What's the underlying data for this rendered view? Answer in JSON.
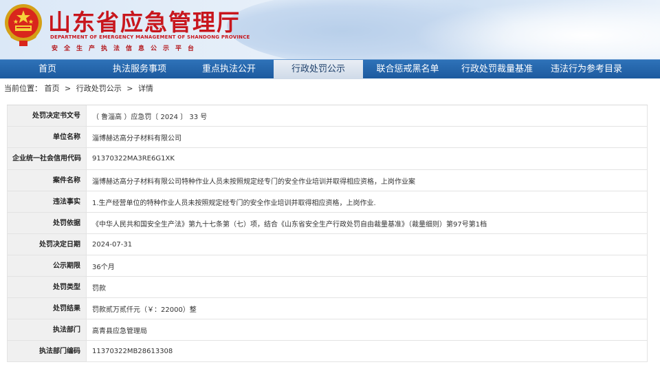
{
  "header": {
    "title_cn": "山东省应急管理厅",
    "title_en": "DEPARTMENT OF EMERGENCY MANAGEMENT OF SHANDONG PROVINCE",
    "subtitle": "安全生产执法信息公示平台",
    "accent_color": "#c8161d"
  },
  "nav": {
    "items": [
      {
        "label": "首页"
      },
      {
        "label": "执法服务事项"
      },
      {
        "label": "重点执法公开"
      },
      {
        "label": "行政处罚公示"
      },
      {
        "label": "联合惩戒黑名单"
      },
      {
        "label": "行政处罚裁量基准"
      },
      {
        "label": "违法行为参考目录"
      }
    ],
    "active_index": 3,
    "color": "#2e72b8"
  },
  "breadcrumb": {
    "prefix": "当前位置：",
    "items": [
      "首页",
      "行政处罚公示",
      "详情"
    ],
    "separator": ">"
  },
  "detail": {
    "rows": [
      {
        "label": "处罚决定书文号",
        "value": "（ 鲁淄高 ）应急罚〔 2024 〕 33 号"
      },
      {
        "label": "单位名称",
        "value": "淄博赫达高分子材料有限公司"
      },
      {
        "label": "企业统一社会信用代码",
        "value": "91370322MA3RE6G1XK"
      },
      {
        "label": "案件名称",
        "value": "淄博赫达高分子材料有限公司特种作业人员未按照规定经专门的安全作业培训并取得相应资格，上岗作业案"
      },
      {
        "label": "违法事实",
        "value": "1.生产经营单位的特种作业人员未按照规定经专门的安全作业培训并取得相应资格，上岗作业."
      },
      {
        "label": "处罚依据",
        "value": "《中华人民共和国安全生产法》第九十七条第（七）项，结合《山东省安全生产行政处罚自由裁量基准》（裁量细则）第97号第1档"
      },
      {
        "label": "处罚决定日期",
        "value": "2024-07-31"
      },
      {
        "label": "公示期限",
        "value": "36个月"
      },
      {
        "label": "处罚类型",
        "value": "罚款"
      },
      {
        "label": "处罚结果",
        "value": "罚款贰万贰仟元（￥：22000）整"
      },
      {
        "label": "执法部门",
        "value": "高青县应急管理局"
      },
      {
        "label": "执法部门编码",
        "value": "11370322MB28613308"
      }
    ]
  }
}
